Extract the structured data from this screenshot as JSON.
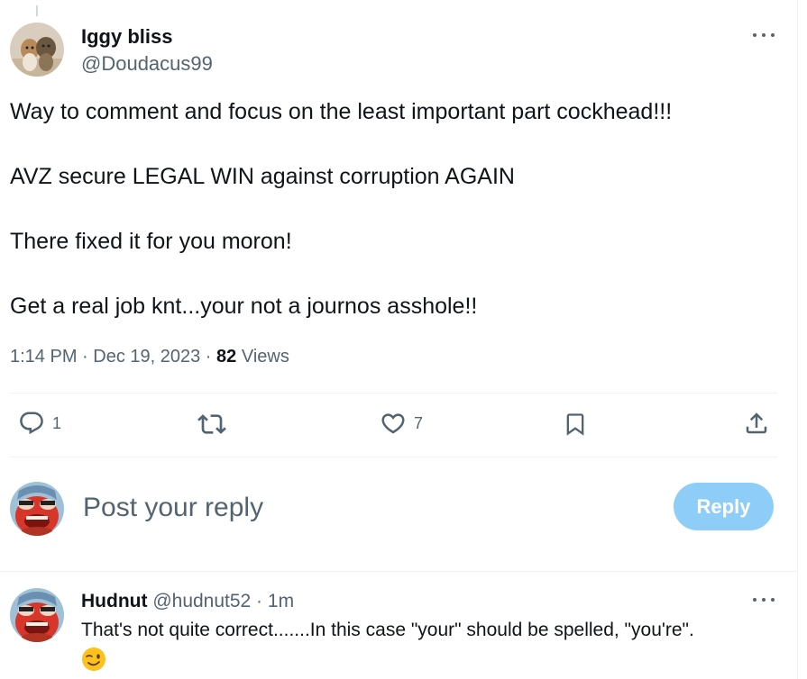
{
  "tweet": {
    "display_name": "Iggy bliss",
    "handle": "@Doudacus99",
    "lines": [
      "Way to comment and focus on the least important part cockhead!!!",
      "AVZ secure LEGAL WIN against corruption AGAIN",
      "There fixed it for you moron!",
      "Get a real job knt...your not a journos asshole!!"
    ],
    "time": "1:14 PM",
    "sep": " · ",
    "date": "Dec 19, 2023",
    "views_count": "82",
    "views_label": " Views"
  },
  "actions": {
    "reply_count": "1",
    "like_count": "7"
  },
  "composer": {
    "placeholder": "Post your reply",
    "button_label": "Reply"
  },
  "reply": {
    "display_name": "Hudnut",
    "handle_time": " @hudnut52 · 1m",
    "text": "That's not quite correct.......In this case \"your\" should be spelled, \"you're\"."
  },
  "icons": {
    "more": "more-dots-icon",
    "reply": "reply-bubble-icon",
    "repost": "repost-icon",
    "like": "heart-icon",
    "bookmark": "bookmark-icon",
    "share": "share-icon",
    "emoji": "winking-face-icon"
  },
  "colors": {
    "text": "#0f1419",
    "secondary": "#536471",
    "reply_button": "#8ecdf8",
    "divider": "#eff3f4"
  }
}
